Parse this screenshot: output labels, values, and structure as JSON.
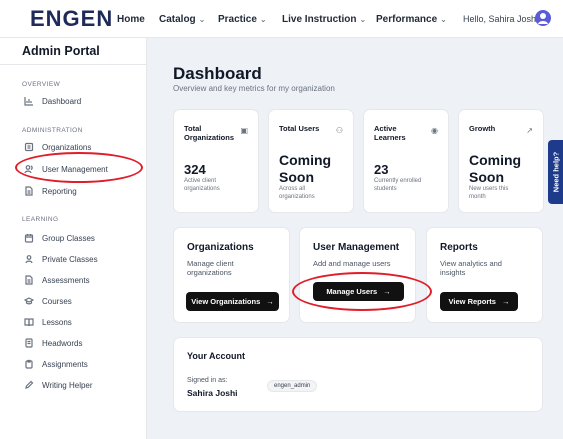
{
  "brand": {
    "logo_text": "ENGEN"
  },
  "topnav": {
    "home": "Home",
    "catalog": "Catalog",
    "practice": "Practice",
    "live_instruction": "Live Instruction",
    "performance": "Performance",
    "greeting": "Hello, Sahira Joshi"
  },
  "sidebar": {
    "title": "Admin Portal",
    "sections": {
      "overview": "OVERVIEW",
      "administration": "ADMINISTRATION",
      "learning": "LEARNING"
    },
    "items": {
      "dashboard": "Dashboard",
      "organizations": "Organizations",
      "user_management": "User Management",
      "reporting": "Reporting",
      "group_classes": "Group Classes",
      "private_classes": "Private Classes",
      "assessments": "Assessments",
      "courses": "Courses",
      "lessons": "Lessons",
      "headwords": "Headwords",
      "assignments": "Assignments",
      "writing_helper": "Writing Helper"
    }
  },
  "main": {
    "title": "Dashboard",
    "subtitle": "Overview and key metrics for my organization",
    "stats": [
      {
        "label": "Total Organizations",
        "value": "324",
        "desc": "Active client organizations",
        "icon": "building-icon"
      },
      {
        "label": "Total Users",
        "value": "Coming Soon",
        "desc": "Across all organizations",
        "icon": "users-icon"
      },
      {
        "label": "Active Learners",
        "value": "23",
        "desc": "Currently enrolled students",
        "icon": "eye-icon"
      },
      {
        "label": "Growth",
        "value": "Coming Soon",
        "desc": "New users this month",
        "icon": "trend-up-icon"
      }
    ],
    "features": [
      {
        "title": "Organizations",
        "desc": "Manage client organizations",
        "button": "View Organizations"
      },
      {
        "title": "User Management",
        "desc": "Add and manage users",
        "button": "Manage Users"
      },
      {
        "title": "Reports",
        "desc": "View analytics and insights",
        "button": "View Reports"
      }
    ],
    "account": {
      "title": "Your Account",
      "signed_in_label": "Signed in as:",
      "name": "Sahira Joshi",
      "username": "engen_admin"
    }
  },
  "help": {
    "label": "Need help?"
  },
  "colors": {
    "accent": "#3b5bdb",
    "brand_dark": "#1e2a5a",
    "annotation": "#e11d2a",
    "help_tab": "#1e3a8a"
  }
}
